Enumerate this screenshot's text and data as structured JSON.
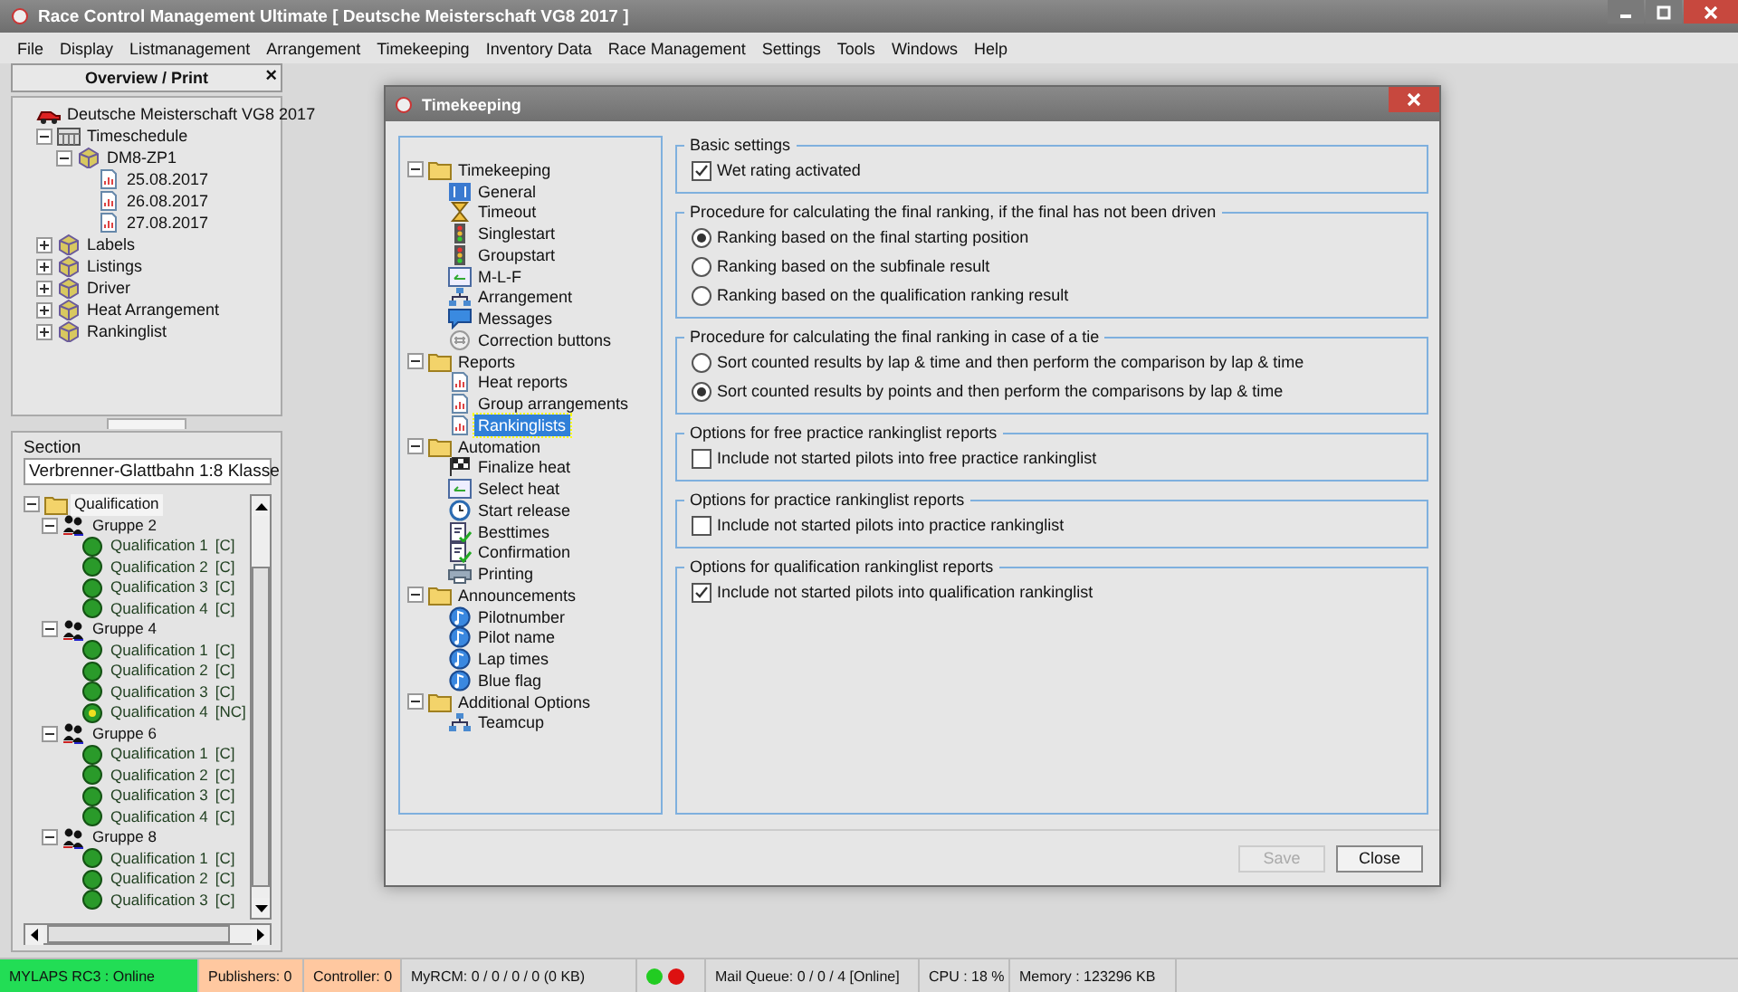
{
  "window": {
    "title": "Race Control Management Ultimate  [ Deutsche Meisterschaft VG8 2017 ]"
  },
  "menu": [
    {
      "label": "File"
    },
    {
      "label": "Display"
    },
    {
      "label": "Listmanagement"
    },
    {
      "label": "Arrangement"
    },
    {
      "label": "Timekeeping"
    },
    {
      "label": "Inventory Data"
    },
    {
      "label": "Race Management"
    },
    {
      "label": "Settings"
    },
    {
      "label": "Tools"
    },
    {
      "label": "Windows"
    },
    {
      "label": "Help"
    }
  ],
  "overview": {
    "title": "Overview / Print",
    "close": "×",
    "tree": [
      {
        "label": "Deutsche Meisterschaft VG8 2017",
        "kind": "car",
        "children": [
          {
            "label": "Timeschedule",
            "kind": "calendar",
            "expanded": true,
            "children": [
              {
                "label": "DM8-ZP1",
                "kind": "cube",
                "expanded": true,
                "children": [
                  {
                    "label": "25.08.2017",
                    "kind": "page"
                  },
                  {
                    "label": "26.08.2017",
                    "kind": "page"
                  },
                  {
                    "label": "27.08.2017",
                    "kind": "page"
                  }
                ]
              }
            ]
          },
          {
            "label": "Labels",
            "kind": "cube",
            "expanded": false
          },
          {
            "label": "Listings",
            "kind": "cube",
            "expanded": false
          },
          {
            "label": "Driver",
            "kind": "cube",
            "expanded": false
          },
          {
            "label": "Heat Arrangement",
            "kind": "cube",
            "expanded": false
          },
          {
            "label": "Rankinglist",
            "kind": "cube",
            "expanded": false
          }
        ]
      }
    ]
  },
  "section": {
    "label": "Section",
    "value": "Verbrenner-Glattbahn 1:8 Klasse"
  },
  "heat_tree": [
    {
      "label": "Qualification",
      "kind": "folder",
      "expanded": true,
      "selected": true,
      "children": [
        {
          "label": "Gruppe 2",
          "kind": "people",
          "expanded": true,
          "selected": false,
          "children": [
            {
              "label": "Qualification 1",
              "result": "[C]",
              "kind": "done",
              "selected": false
            },
            {
              "label": "Qualification 2",
              "result": "[C]",
              "kind": "done",
              "selected": false
            },
            {
              "label": "Qualification 3",
              "result": "[C]",
              "kind": "done",
              "selected": false
            },
            {
              "label": "Qualification 4",
              "result": "[C]",
              "kind": "done",
              "selected": false
            }
          ]
        },
        {
          "label": "Gruppe 4",
          "kind": "people",
          "expanded": true,
          "selected": false,
          "children": [
            {
              "label": "Qualification 1",
              "result": "[C]",
              "kind": "done",
              "selected": false
            },
            {
              "label": "Qualification 2",
              "result": "[C]",
              "kind": "done",
              "selected": false
            },
            {
              "label": "Qualification 3",
              "result": "[C]",
              "kind": "done",
              "selected": false
            },
            {
              "label": "Qualification 4",
              "result": "[NC]",
              "kind": "pending",
              "selected": false
            }
          ]
        },
        {
          "label": "Gruppe 6",
          "kind": "people",
          "expanded": true,
          "selected": false,
          "children": [
            {
              "label": "Qualification 1",
              "result": "[C]",
              "kind": "done",
              "selected": false
            },
            {
              "label": "Qualification 2",
              "result": "[C]",
              "kind": "done",
              "selected": false
            },
            {
              "label": "Qualification 3",
              "result": "[C]",
              "kind": "done",
              "selected": false
            },
            {
              "label": "Qualification 4",
              "result": "[C]",
              "kind": "done",
              "selected": false
            }
          ]
        },
        {
          "label": "Gruppe 8",
          "kind": "people",
          "expanded": true,
          "selected": false,
          "children": [
            {
              "label": "Qualification 1",
              "result": "[C]",
              "kind": "done",
              "selected": false
            },
            {
              "label": "Qualification 2",
              "result": "[C]",
              "kind": "done",
              "selected": false
            },
            {
              "label": "Qualification 3",
              "result": "[C]",
              "kind": "done",
              "selected": false
            }
          ]
        }
      ]
    }
  ],
  "dialog": {
    "title": "Timekeeping",
    "nav": [
      {
        "label": "Timekeeping",
        "kind": "folder",
        "expanded": true,
        "selected": false,
        "children": [
          {
            "label": "General",
            "kind": "settings",
            "selected": false
          },
          {
            "label": "Timeout",
            "kind": "hourglass",
            "selected": false
          },
          {
            "label": "Singlestart",
            "kind": "traffic-light",
            "selected": false
          },
          {
            "label": "Groupstart",
            "kind": "traffic-light",
            "selected": false
          },
          {
            "label": "M-L-F",
            "kind": "window",
            "selected": false
          },
          {
            "label": "Arrangement",
            "kind": "network",
            "selected": false
          },
          {
            "label": "Messages",
            "kind": "message",
            "selected": false
          },
          {
            "label": "Correction buttons",
            "kind": "counter",
            "selected": false
          }
        ]
      },
      {
        "label": "Reports",
        "kind": "folder",
        "expanded": true,
        "selected": false,
        "children": [
          {
            "label": "Heat reports",
            "kind": "page",
            "selected": false
          },
          {
            "label": "Group arrangements",
            "kind": "page",
            "selected": false
          },
          {
            "label": "Rankinglists",
            "kind": "page",
            "selected": true
          }
        ]
      },
      {
        "label": "Automation",
        "kind": "folder",
        "expanded": true,
        "selected": false,
        "children": [
          {
            "label": "Finalize heat",
            "kind": "flag",
            "selected": false
          },
          {
            "label": "Select heat",
            "kind": "window",
            "selected": false
          },
          {
            "label": "Start release",
            "kind": "clock",
            "selected": false
          },
          {
            "label": "Besttimes",
            "kind": "check-doc",
            "selected": false
          },
          {
            "label": "Confirmation",
            "kind": "check-doc",
            "selected": false
          },
          {
            "label": "Printing",
            "kind": "printer",
            "selected": false
          }
        ]
      },
      {
        "label": "Announcements",
        "kind": "folder",
        "expanded": true,
        "selected": false,
        "children": [
          {
            "label": "Pilotnumber",
            "kind": "note",
            "selected": false
          },
          {
            "label": "Pilot name",
            "kind": "note",
            "selected": false
          },
          {
            "label": "Lap times",
            "kind": "note",
            "selected": false
          },
          {
            "label": "Blue flag",
            "kind": "note",
            "selected": false
          }
        ]
      },
      {
        "label": "Additional Options",
        "kind": "folder",
        "expanded": true,
        "selected": false,
        "children": [
          {
            "label": "Teamcup",
            "kind": "network",
            "selected": false
          }
        ]
      }
    ],
    "sections": [
      {
        "title": "Basic settings",
        "options": [
          {
            "kind": "checkbox",
            "label": "Wet rating activated",
            "checked": true
          }
        ]
      },
      {
        "title": "Procedure for calculating the final ranking, if the final has not been driven",
        "options": [
          {
            "kind": "radio",
            "label": "Ranking based on the final starting position",
            "selected": true
          },
          {
            "kind": "radio",
            "label": "Ranking based on the subfinale result",
            "selected": false
          },
          {
            "kind": "radio",
            "label": "Ranking based on the qualification ranking result",
            "selected": false
          }
        ]
      },
      {
        "title": "Procedure for calculating the final ranking in case of a tie",
        "options": [
          {
            "kind": "radio",
            "label": "Sort counted results by lap & time and then perform the comparison by lap & time",
            "selected": false
          },
          {
            "kind": "radio",
            "label": "Sort counted results by points and then perform the comparisons by lap & time",
            "selected": true
          }
        ]
      },
      {
        "title": "Options for free practice rankinglist reports",
        "options": [
          {
            "kind": "checkbox",
            "label": "Include not started pilots into free practice rankinglist",
            "checked": false
          }
        ]
      },
      {
        "title": "Options for practice rankinglist reports",
        "options": [
          {
            "kind": "checkbox",
            "label": "Include not started pilots into practice rankinglist",
            "checked": false
          }
        ]
      },
      {
        "title": "Options for qualification rankinglist reports",
        "options": [
          {
            "kind": "checkbox",
            "label": "Include not started pilots into qualification rankinglist",
            "checked": true
          }
        ]
      }
    ],
    "buttons": [
      {
        "label": "Save",
        "disabled": true
      },
      {
        "label": "Close",
        "disabled": false
      }
    ]
  },
  "status_bar": [
    {
      "kind": "text",
      "text": "MYLAPS RC3 : Online",
      "color": "#22dd55"
    },
    {
      "kind": "text",
      "text": "Publishers: 0",
      "color": "#ffc8a0"
    },
    {
      "kind": "text",
      "text": "Controller: 0",
      "color": "#ffc8a0"
    },
    {
      "kind": "text",
      "text": "MyRCM: 0 / 0 / 0 / 0 (0 KB)"
    },
    {
      "kind": "lights",
      "lights": [
        {
          "color": "#22cc22"
        },
        {
          "color": "#dd1111"
        }
      ]
    },
    {
      "kind": "text",
      "text": "Mail Queue: 0 / 0 / 4 [Online]"
    },
    {
      "kind": "text",
      "text": "CPU : 18 %"
    },
    {
      "kind": "text",
      "text": "Memory : 123296 KB"
    }
  ]
}
